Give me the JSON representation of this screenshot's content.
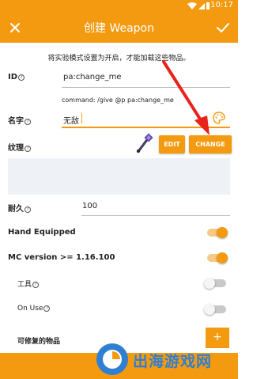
{
  "status_bar": {
    "time": "10:17"
  },
  "app_bar": {
    "title": "创建 Weapon"
  },
  "notice": "将实验模式设置为开启，才能加载这些物品。",
  "id_field": {
    "label": "ID",
    "value": "pa:change_me"
  },
  "command_text": "command: /give @p pa:change_me",
  "name_field": {
    "label": "名字",
    "value": "无敌"
  },
  "texture": {
    "label": "纹理",
    "edit_label": "EDIT",
    "change_label": "CHANGE"
  },
  "durability": {
    "label": "耐久",
    "value": "100"
  },
  "hand_equipped": {
    "label": "Hand Equipped",
    "on": true
  },
  "mc_version": {
    "label": "MC version >= 1.16.100",
    "on": true
  },
  "tool": {
    "label": "工具",
    "on": false
  },
  "on_use": {
    "label": "On Use",
    "on": false
  },
  "repairable": {
    "label": "可修复的物品",
    "add_label": "+"
  },
  "watermark": {
    "text": "出海游戏网"
  },
  "colors": {
    "accent": "#f39a10",
    "annotation_arrow": "#e8231c"
  }
}
